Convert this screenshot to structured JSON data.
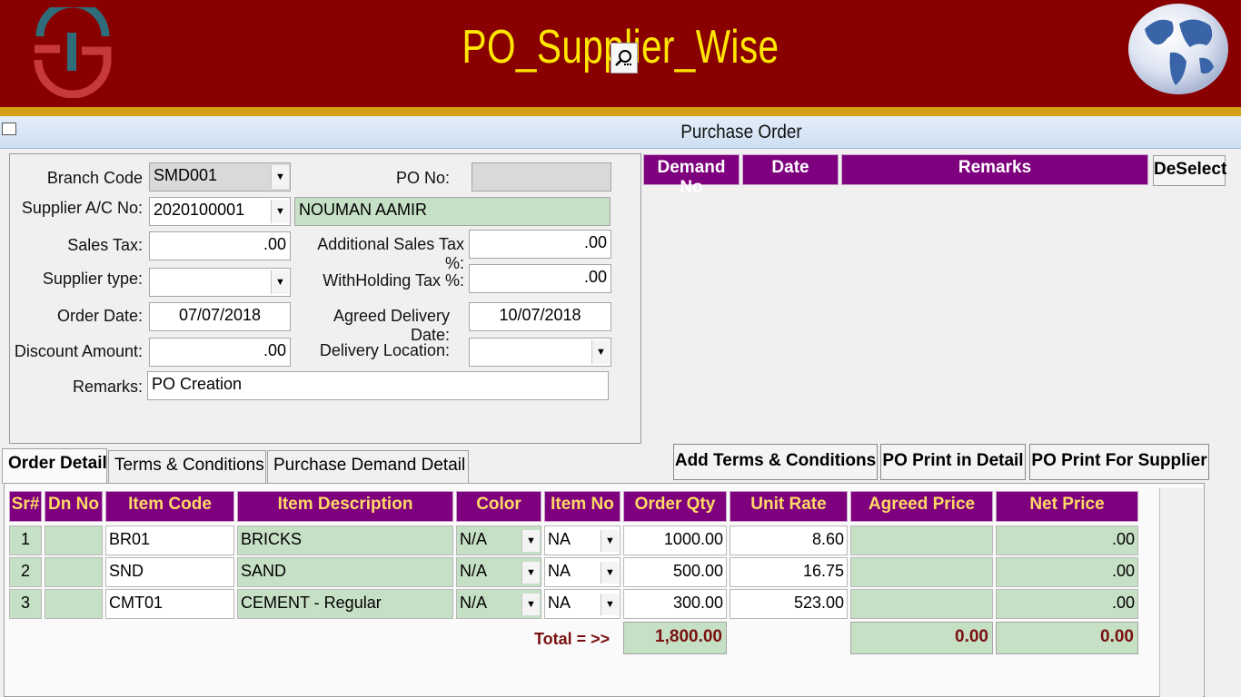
{
  "header": {
    "title": "PO_Supplier_Wise"
  },
  "window": {
    "title": "Purchase Order"
  },
  "form": {
    "branch_code_label": "Branch Code",
    "branch_code_value": "SMD001",
    "po_no_label": "PO No:",
    "po_no_value": "",
    "supplier_ac_label": "Supplier A/C No:",
    "supplier_ac_value": "2020100001",
    "supplier_name": "NOUMAN AAMIR",
    "sales_tax_label": "Sales Tax:",
    "sales_tax_value": ".00",
    "add_sales_tax_label": "Additional Sales Tax %:",
    "add_sales_tax_value": ".00",
    "supplier_type_label": "Supplier type:",
    "supplier_type_value": "",
    "withholding_label": "WithHolding Tax %:",
    "withholding_value": ".00",
    "order_date_label": "Order Date:",
    "order_date_value": "07/07/2018",
    "agreed_delivery_label": "Agreed Delivery Date:",
    "agreed_delivery_value": "10/07/2018",
    "discount_label": "Discount Amount:",
    "discount_value": ".00",
    "delivery_location_label": "Delivery Location:",
    "delivery_location_value": "",
    "remarks_label": "Remarks:",
    "remarks_value": "PO Creation"
  },
  "demand_list": {
    "headers": [
      "Demand No",
      "Date",
      "Remarks"
    ],
    "deselect_label": "DeSelect"
  },
  "tabs": [
    {
      "label": "Order Detail",
      "active": true
    },
    {
      "label": "Terms & Conditions",
      "active": false
    },
    {
      "label": "Purchase Demand Detail",
      "active": false
    }
  ],
  "actions": {
    "add_terms": "Add Terms & Conditions",
    "print_detail": "PO Print in Detail",
    "print_supplier": "PO Print For Supplier"
  },
  "grid": {
    "headers": [
      "Sr#",
      "Dn No",
      "Item Code",
      "Item Description",
      "Color",
      "Item No",
      "Order Qty",
      "Unit Rate",
      "Agreed Price",
      "Net Price"
    ],
    "rows": [
      {
        "sr": "1",
        "dn": "",
        "code": "BR01",
        "desc": "BRICKS",
        "color": "N/A",
        "item_no": "NA",
        "qty": "1000.00",
        "rate": "8.60",
        "agreed": "",
        "net": ".00"
      },
      {
        "sr": "2",
        "dn": "",
        "code": "SND",
        "desc": "SAND",
        "color": "N/A",
        "item_no": "NA",
        "qty": "500.00",
        "rate": "16.75",
        "agreed": "",
        "net": ".00"
      },
      {
        "sr": "3",
        "dn": "",
        "code": "CMT01",
        "desc": "CEMENT - Regular",
        "color": "N/A",
        "item_no": "NA",
        "qty": "300.00",
        "rate": "523.00",
        "agreed": "",
        "net": ".00"
      }
    ],
    "total_label": "Total = >>",
    "total_qty": "1,800.00",
    "total_agreed": "0.00",
    "total_net": "0.00"
  },
  "icons": {
    "dropdown": "chevron-down-icon",
    "search": "search-icon"
  },
  "colors": {
    "banner": "#880000",
    "title": "#ffe600",
    "header_purple": "#7e007e",
    "cell_green": "#c6e0c6"
  }
}
